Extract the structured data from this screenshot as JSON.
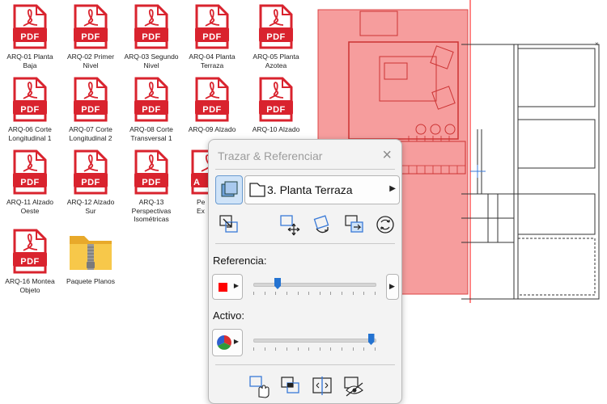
{
  "desktop": {
    "icons": [
      {
        "type": "pdf",
        "badge": "PDF",
        "label": "ARQ-01 Planta Baja"
      },
      {
        "type": "pdf",
        "badge": "PDF",
        "label": "ARQ-02 Primer Nivel"
      },
      {
        "type": "pdf",
        "badge": "PDF",
        "label": "ARQ-03 Segundo Nivel"
      },
      {
        "type": "pdf",
        "badge": "PDF",
        "label": "ARQ-04 Planta Terraza"
      },
      {
        "type": "pdf",
        "badge": "PDF",
        "label": "ARQ-05 Planta Azotea"
      },
      {
        "type": "pdf",
        "badge": "PDF",
        "label": "ARQ-06 Corte Longitudinal 1"
      },
      {
        "type": "pdf",
        "badge": "PDF",
        "label": "ARQ-07 Corte Longitudinal 2"
      },
      {
        "type": "pdf",
        "badge": "PDF",
        "label": "ARQ-08 Corte Transversal 1"
      },
      {
        "type": "pdf",
        "badge": "PDF",
        "label": "ARQ-09 Alzado"
      },
      {
        "type": "pdf",
        "badge": "PDF",
        "label": "ARQ-10 Alzado"
      },
      {
        "type": "pdf",
        "badge": "PDF",
        "label": "ARQ-11 Alzado Oeste"
      },
      {
        "type": "pdf",
        "badge": "PDF",
        "label": "ARQ-12 Alzado Sur"
      },
      {
        "type": "pdf",
        "badge": "PDF",
        "label": "ARQ-13 Perspectivas Isométricas"
      },
      {
        "type": "pdf",
        "badge": "PDF",
        "label": "ARQ-16 Montea Objeto"
      },
      {
        "type": "zip-folder",
        "badge": "",
        "label": "Paquete Planos"
      }
    ],
    "partial_icon": {
      "badge": "A",
      "label": "Pe Ex"
    }
  },
  "palette": {
    "title": "Trazar & Referenciar",
    "close_icon": "close-icon",
    "reference_view": "3. Planta Terraza",
    "referencia_label": "Referencia:",
    "activo_label": "Activo:",
    "referencia_color": "#ff0000",
    "referencia_slider": 0.2,
    "activo_slider": 0.97
  },
  "colors": {
    "pdf_red": "#d9232e",
    "reference_overlay": "#f48c8c",
    "trace_line": "#ff3333"
  }
}
